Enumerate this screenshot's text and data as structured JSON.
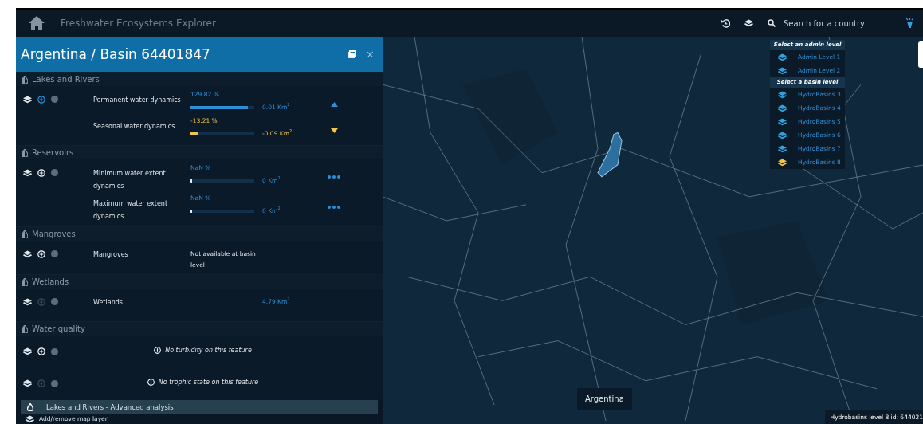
{
  "navbar": {
    "title": "Freshwater Ecosystems Explorer",
    "search": {
      "placeholder": "Search for a country"
    }
  },
  "panel": {
    "title": "Argentina / Basin 64401847",
    "sections": [
      {
        "title": "Lakes and Rivers",
        "groups": [
          {
            "add_highlighted": true,
            "add_disabled": false,
            "rows": [
              {
                "kind": "increase",
                "label": "Permanent water dynamics",
                "percent": "129.82 %",
                "level": 0.9,
                "area": "0.01 Km$^{2}$"
              },
              {
                "kind": "decrease",
                "label": "Seasonal water dynamics",
                "percent": "-13.21 %",
                "level": 0.13,
                "area": "-0.09 Km$^{2}$"
              }
            ]
          }
        ]
      },
      {
        "title": "Reservoirs",
        "groups": [
          {
            "add_highlighted": false,
            "add_disabled": false,
            "rows": [
              {
                "kind": "unknown",
                "label": "Minimum water extent dynamics",
                "percent": "NaN %",
                "level": 0.01,
                "area": "0 Km$^{2}$"
              },
              {
                "kind": "unknown",
                "label": "Maximum water extent dynamics",
                "percent": "NaN %",
                "level": 0.01,
                "area": "0 Km$^{2}$"
              }
            ]
          }
        ]
      },
      {
        "title": "Mangroves",
        "groups": [
          {
            "add_highlighted": false,
            "add_disabled": false,
            "rows": [
              {
                "kind": "note",
                "label": "Mangroves",
                "note": "Not available at basin level"
              }
            ]
          }
        ]
      },
      {
        "title": "Wetlands",
        "groups": [
          {
            "add_highlighted": false,
            "add_disabled": true,
            "rows": [
              {
                "kind": "area",
                "label": "Wetlands",
                "area": "4.79 Km$^{2}$"
              }
            ]
          }
        ]
      },
      {
        "title": "Water quality",
        "groups": [
          {
            "add_highlighted": false,
            "add_disabled": false,
            "rows": [
              {
                "kind": "message",
                "message": "No turbidity on this feature"
              }
            ]
          },
          {
            "add_highlighted": false,
            "add_disabled": true,
            "rows": [
              {
                "kind": "message",
                "message": "No trophic state on this feature"
              }
            ]
          }
        ]
      }
    ],
    "advanced": "Lakes and Rivers - Advanced analysis",
    "layer_toggle": "Add/remove map layer"
  },
  "map": {
    "kind": "picture",
    "layer_menu": [
      {
        "heading": "Select an admin level",
        "items": [
          {
            "label": "Admin Level 1",
            "selected": false
          },
          {
            "label": "Admin Level 2",
            "selected": false
          }
        ]
      },
      {
        "heading": "Select a basin level",
        "items": [
          {
            "label": "HydroBasins 3",
            "selected": false
          },
          {
            "label": "HydroBasins 4",
            "selected": false
          },
          {
            "label": "HydroBasins 5",
            "selected": false
          },
          {
            "label": "HydroBasins 6",
            "selected": false
          },
          {
            "label": "HydroBasins 7",
            "selected": false
          },
          {
            "label": "HydroBasins 8",
            "selected": true
          }
        ]
      }
    ],
    "tooltip": "Argentina",
    "status": "Hydrobasins level 8 id: 644021"
  }
}
